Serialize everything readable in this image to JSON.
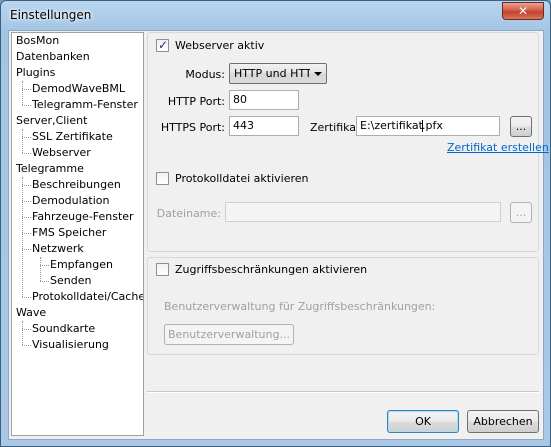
{
  "window": {
    "title": "Einstellungen",
    "close_glyph": "✕"
  },
  "tree": {
    "items": [
      {
        "label": "BosMon",
        "level": 0
      },
      {
        "label": "Datenbanken",
        "level": 0
      },
      {
        "label": "Plugins",
        "level": 0
      },
      {
        "label": "DemodWaveBML",
        "level": 1
      },
      {
        "label": "Telegramm-Fenster",
        "level": 1
      },
      {
        "label": "Server,Client",
        "level": 0
      },
      {
        "label": "SSL Zertifikate",
        "level": 1
      },
      {
        "label": "Webserver",
        "level": 1
      },
      {
        "label": "Telegramme",
        "level": 0
      },
      {
        "label": "Beschreibungen",
        "level": 1
      },
      {
        "label": "Demodulation",
        "level": 1
      },
      {
        "label": "Fahrzeuge-Fenster",
        "level": 1
      },
      {
        "label": "FMS Speicher",
        "level": 1
      },
      {
        "label": "Netzwerk",
        "level": 1
      },
      {
        "label": "Empfangen",
        "level": 2
      },
      {
        "label": "Senden",
        "level": 2
      },
      {
        "label": "Protokolldatei/Cache",
        "level": 1
      },
      {
        "label": "Wave",
        "level": 0
      },
      {
        "label": "Soundkarte",
        "level": 1
      },
      {
        "label": "Visualisierung",
        "level": 1
      }
    ]
  },
  "webserver": {
    "enable_label": "Webserver aktiv",
    "enabled": true,
    "mode_label": "Modus:",
    "mode_value": "HTTP und HTTPS",
    "http_port_label": "HTTP Port:",
    "http_port_value": "80",
    "https_port_label": "HTTPS Port:",
    "https_port_value": "443",
    "cert_label": "Zertifikat:",
    "cert_value_before_caret": "E:\\zertifikat",
    "cert_value_after_caret": ".pfx",
    "browse_label": "...",
    "create_cert_link": "Zertifikat erstellen"
  },
  "logfile": {
    "enable_label": "Protokolldatei aktivieren",
    "enabled": false,
    "filename_label": "Dateiname:",
    "filename_value": "",
    "browse_label": "..."
  },
  "access": {
    "enable_label": "Zugriffsbeschränkungen aktivieren",
    "enabled": false,
    "user_mgmt_caption": "Benutzerverwaltung für Zugriffsbeschränkungen:",
    "user_mgmt_button": "Benutzerverwaltung..."
  },
  "footer": {
    "ok_label": "OK",
    "cancel_label": "Abbrechen"
  },
  "colors": {
    "link": "#0066cc",
    "title_bar": "#a8c8e6",
    "close_button": "#c4412b"
  }
}
